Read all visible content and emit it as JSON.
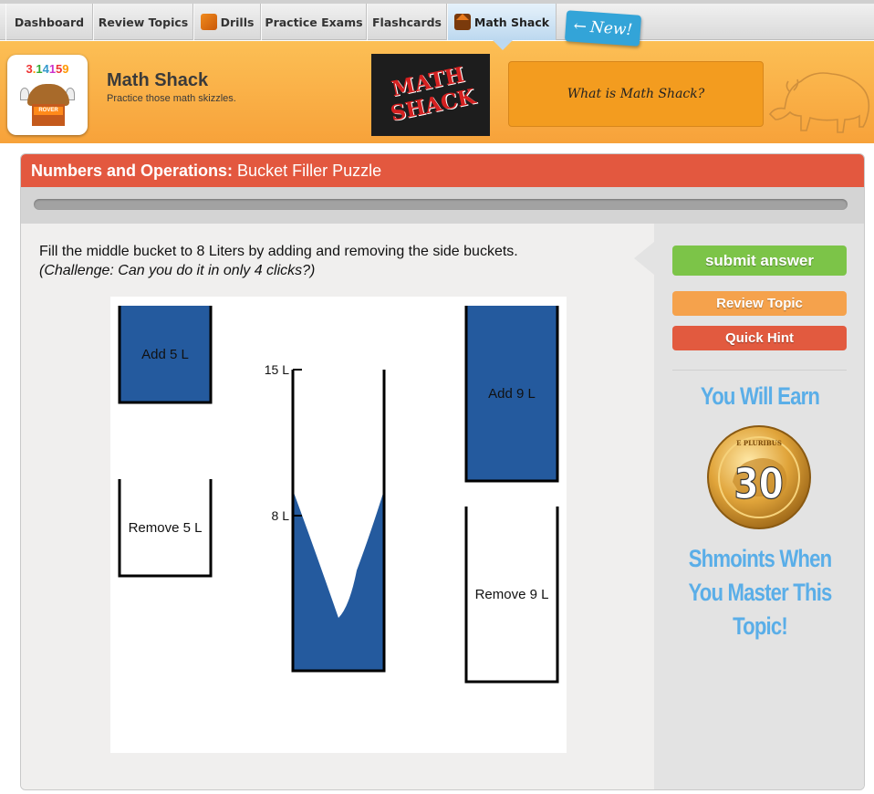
{
  "nav": {
    "tabs": [
      {
        "label": "Dashboard"
      },
      {
        "label": "Review Topics"
      },
      {
        "label": "Drills"
      },
      {
        "label": "Practice Exams"
      },
      {
        "label": "Flashcards"
      },
      {
        "label": "Math Shack"
      }
    ],
    "active_tab": "Math Shack",
    "new_badge": "New!"
  },
  "header": {
    "logo_digits": "3.14159",
    "logo_sign": "ROVER",
    "title": "Math Shack",
    "subtitle": "Practice those math skizzles.",
    "banner_text": "MATH SHACK",
    "what_button": "What is Math Shack?"
  },
  "panel": {
    "category": "Numbers and Operations:",
    "topic": "Bucket Filler Puzzle",
    "progress": 0.0
  },
  "puzzle": {
    "instruction": "Fill the middle bucket to 8 Liters by adding and removing the side buckets.",
    "challenge": "(Challenge: Can you do it in only 4 clicks?)",
    "add5_label": "Add 5 L",
    "remove5_label": "Remove 5 L",
    "add9_label": "Add 9 L",
    "remove9_label": "Remove 9 L",
    "max_label": "15 L",
    "target_label": "8 L"
  },
  "sidebar": {
    "submit": "submit answer",
    "review": "Review Topic",
    "hint": "Quick Hint",
    "earn_top": "You Will Earn",
    "points": "30",
    "coin_text": "E PLURIBUS",
    "earn_line1": "Shmoints When",
    "earn_line2": "You Master This",
    "earn_line3": "Topic!"
  },
  "colors": {
    "water": "#245a9e",
    "orange": "#f7a23a",
    "header_red": "#e3583f",
    "submit_green": "#7cc448",
    "earn_blue": "#5aaee8"
  }
}
